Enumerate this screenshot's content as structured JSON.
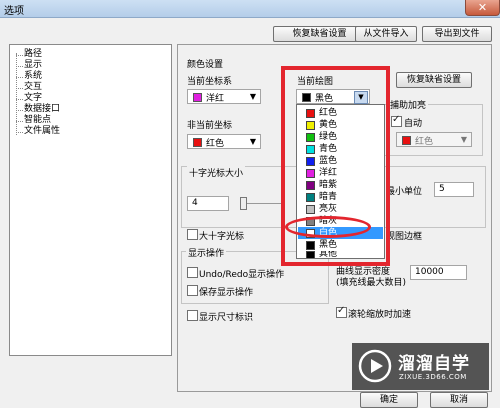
{
  "window": {
    "title": "选项",
    "close_glyph": "✕"
  },
  "top_buttons": {
    "restore_defaults": "恢复缺省设置",
    "import": "从文件导入",
    "export": "导出到文件"
  },
  "tree": {
    "items": [
      "路径",
      "显示",
      "系统",
      "交互",
      "文字",
      "数据接口",
      "智能点",
      "文件属性"
    ]
  },
  "color_settings": {
    "group_title": "颜色设置",
    "current_coord_label": "当前坐标系",
    "current_coord_value": "洋红",
    "current_draw_label": "当前绘图",
    "current_draw_value": "黑色",
    "restore_defaults": "恢复缺省设置",
    "noncurrent_coord_label": "非当前坐标",
    "noncurrent_coord_value": "红色",
    "aux_highlight_label": "捕助加亮",
    "auto_label": "自动",
    "aux_color_value": "红色"
  },
  "colors": {
    "magenta": "#e020e0",
    "red": "#e81010",
    "black": "#000000",
    "yellow": "#f0f000",
    "green": "#10c010",
    "cyan": "#00e0e0",
    "blue": "#1020f0",
    "purple": "#800080",
    "teal": "#008080",
    "lightgray": "#c0c0c0",
    "darkgray": "#808080",
    "white": "#ffffff"
  },
  "dropdown": {
    "items": [
      {
        "label": "红色",
        "color": "#e81010"
      },
      {
        "label": "黄色",
        "color": "#f0f000"
      },
      {
        "label": "绿色",
        "color": "#10c010"
      },
      {
        "label": "青色",
        "color": "#00e0e0"
      },
      {
        "label": "蓝色",
        "color": "#1020f0"
      },
      {
        "label": "洋红",
        "color": "#e020e0"
      },
      {
        "label": "暗紫",
        "color": "#800080"
      },
      {
        "label": "暗青",
        "color": "#008080"
      },
      {
        "label": "亮灰",
        "color": "#c0c0c0"
      },
      {
        "label": "暗灰",
        "color": "#808080"
      },
      {
        "label": "白色",
        "color": "#ffffff"
      },
      {
        "label": "黑色",
        "color": "#000000"
      },
      {
        "label": "其他",
        "color": "#000000"
      }
    ],
    "selected_index": 10
  },
  "cursor": {
    "group_title": "十字光标大小",
    "size_value": "4",
    "min_unit_label": "最小单位",
    "min_unit_value": "5",
    "large_cursor_label": "大十字光标",
    "viewport_border_label": "视图边框"
  },
  "display_ops": {
    "group_title": "显示操作",
    "undo_redo_label": "Undo/Redo显示操作",
    "save_display_label": "保存显示操作",
    "show_dim_label": "显示尺寸标识",
    "density_label": "曲线显示密度",
    "density_sub": "(填充线最大数目)",
    "density_value": "10000",
    "wheel_label": "滚轮缩放时加速"
  },
  "bottom_buttons": {
    "ok": "确定",
    "cancel": "取消"
  },
  "watermark": {
    "brand": "溜溜自学",
    "url": "ZIXUE.3D66.COM"
  }
}
